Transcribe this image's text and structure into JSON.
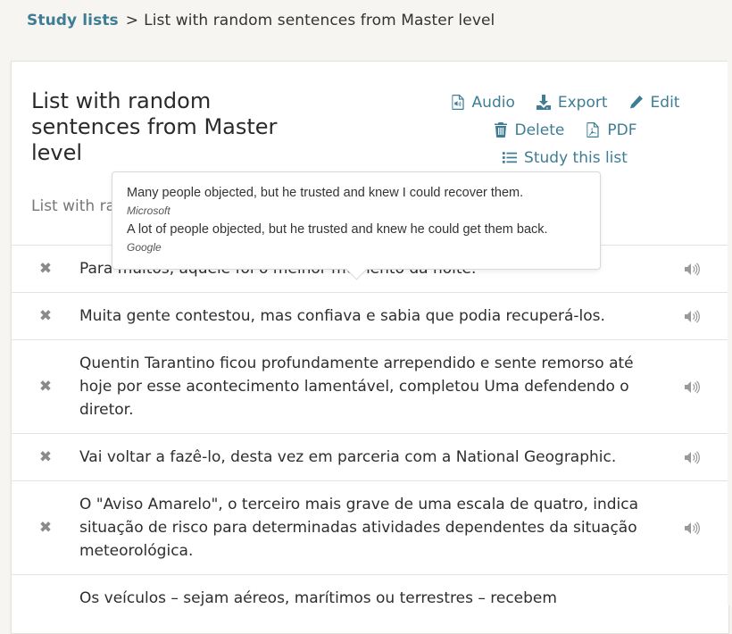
{
  "breadcrumb": {
    "parent": "Study lists",
    "separator": ">",
    "current": "List with random sentences from Master level"
  },
  "list": {
    "title": "List with random sentences from Master level",
    "description": "List with random sentences from Master level"
  },
  "actions": {
    "audio": "Audio",
    "export": "Export",
    "edit": "Edit",
    "delete": "Delete",
    "pdf": "PDF",
    "study": "Study this list"
  },
  "tooltip": {
    "translations": [
      {
        "text": "Many people objected, but he trusted and knew I could recover them.",
        "source": "Microsoft"
      },
      {
        "text": "A lot of people objected, but he trusted and knew he could get them back.",
        "source": "Google"
      }
    ]
  },
  "sentences": [
    {
      "text": "Para muitos, aquele foi o melhor momento da noite."
    },
    {
      "text": "Muita gente contestou, mas confiava e sabia que podia recuperá-los."
    },
    {
      "text": "Quentin Tarantino ficou profundamente arrependido e sente remorso até hoje por esse acontecimento lamentável, completou Uma defendendo o diretor."
    },
    {
      "text": "Vai voltar a fazê-lo, desta vez em parceria com a National Geographic."
    },
    {
      "text": "O \"Aviso Amarelo\", o terceiro mais grave de uma escala de quatro, indica situação de risco para determinadas atividades dependentes da situação meteorológica."
    },
    {
      "text": "Os veículos – sejam aéreos, marítimos ou terrestres – recebem"
    }
  ],
  "icons": {
    "delete_row": "✖"
  }
}
